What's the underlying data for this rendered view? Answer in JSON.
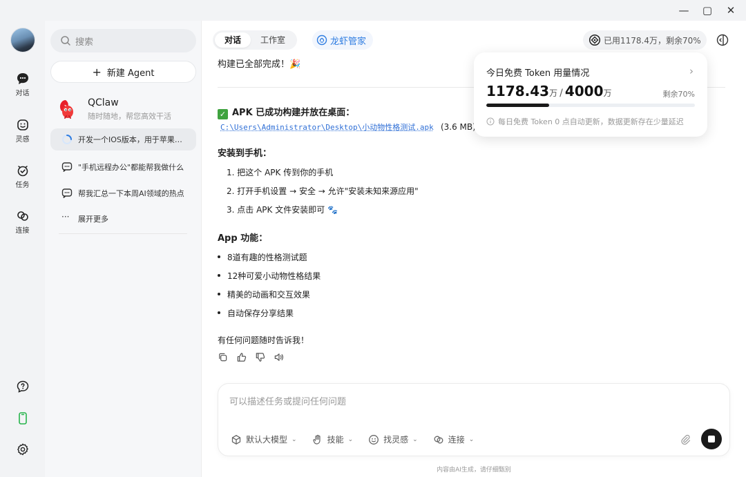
{
  "window": {
    "min_icon": "minimize-icon",
    "max_icon": "maximize-icon",
    "close_icon": "close-icon"
  },
  "rail": {
    "items": [
      {
        "label": "对话",
        "icon": "chat-icon"
      },
      {
        "label": "灵感",
        "icon": "smile-icon"
      },
      {
        "label": "任务",
        "icon": "task-icon"
      },
      {
        "label": "连接",
        "icon": "link-icon"
      }
    ],
    "bottom_icons": [
      "help-icon",
      "phone-icon",
      "settings-icon"
    ]
  },
  "sidebar": {
    "search_placeholder": "搜索",
    "new_agent": "新建 Agent",
    "qclaw": {
      "name": "QClaw",
      "desc": "随时随地，帮您高效干活"
    },
    "conversations": [
      {
        "text": "开发一个IOS版本，用于苹果手机",
        "icon": "loading-icon",
        "active": true
      },
      {
        "text": "\"手机远程办公\"都能帮我做什么",
        "icon": "chat-bubble-icon"
      },
      {
        "text": "帮我汇总一下本周AI领域的热点",
        "icon": "chat-bubble-icon"
      }
    ],
    "expand_more": "展开更多",
    "expand_icon": "ellipsis-icon"
  },
  "header": {
    "tabs": [
      "对话",
      "工作室"
    ],
    "active_tab": "对话",
    "assistant_name": "龙虾管家",
    "usage_pill": "已用1178.4万，剩余70%"
  },
  "message": {
    "top_line": "构建已全部完成！🎉",
    "apk_heading": "APK 已成功构建并放在桌面：",
    "apk_path": "C:\\Users\\Administrator\\Desktop\\小动物性格测试.apk",
    "apk_size": "(3.6 MB)",
    "install_heading": "安装到手机：",
    "install_steps": [
      "1. 把这个 APK 传到你的手机",
      "2. 打开手机设置 → 安全 → 允许\"安装未知来源应用\"",
      "3. 点击 APK 文件安装即可 🐾"
    ],
    "features_heading": "App 功能：",
    "features": [
      "8道有趣的性格测试题",
      "12种可爱小动物性格结果",
      "精美的动画和交互效果",
      "自动保存分享结果"
    ],
    "closing": "有任何问题随时告诉我！"
  },
  "token_popup": {
    "title": "今日免费 Token 用量情况",
    "used": "1178.43",
    "total": "4000",
    "unit": "万",
    "remain": "剩余70%",
    "used_fraction": 0.3,
    "note": "每日免费 Token 0 点自动更新，数据更新存在少量延迟"
  },
  "composer": {
    "placeholder": "可以描述任务或提问任何问题",
    "tools": [
      "默认大模型",
      "技能",
      "找灵感",
      "连接"
    ]
  },
  "disclaimer": "内容由AI生成，请仔细甄别"
}
